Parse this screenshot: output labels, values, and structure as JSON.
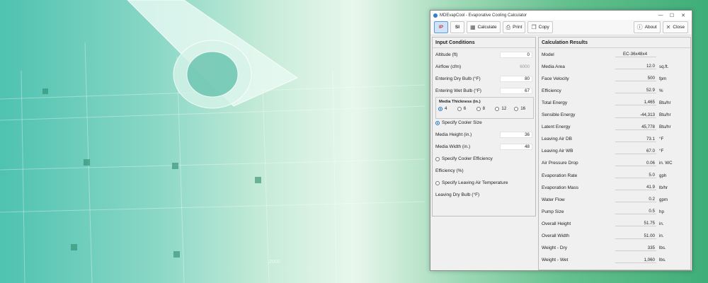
{
  "window": {
    "title": "MDEvapCool - Evaporative Cooling Calculator",
    "controls": [
      "—",
      "☐",
      "✕"
    ]
  },
  "toolbar": {
    "ip_label": "IP",
    "si_label": "SI",
    "calculate_label": "Calculate",
    "print_label": "Print",
    "copy_label": "Copy",
    "about_label": "About",
    "close_label": "Close"
  },
  "input": {
    "title": "Input Conditions",
    "altitude": {
      "label": "Altitude (ft)",
      "value": "0"
    },
    "airflow": {
      "label": "Airflow (cfm)",
      "value": "6000"
    },
    "dry_bulb": {
      "label": "Entering Dry Bulb (°F)",
      "value": "80"
    },
    "wet_bulb": {
      "label": "Entering Wet Bulb (°F)",
      "value": "67"
    },
    "thickness": {
      "title": "Media Thickness (in.)",
      "options": [
        "4",
        "6",
        "8",
        "12",
        "16"
      ],
      "selected": "4"
    },
    "specify_size": "Specify Cooler Size",
    "media_height": {
      "label": "Media Height (in.)",
      "value": "36"
    },
    "media_width": {
      "label": "Media Width (in.)",
      "value": "48"
    },
    "specify_efficiency": "Specify Cooler Efficiency",
    "efficiency_label": "Efficiency (%)",
    "specify_leaving": "Specify Leaving Air Temperature",
    "leaving_db_label": "Leaving Dry Bulb (°F)"
  },
  "results": {
    "title": "Calculation Results",
    "rows": [
      {
        "label": "Model",
        "value": "EC-36x48x4",
        "unit": ""
      },
      {
        "label": "Media Area",
        "value": "12.0",
        "unit": "sq.ft."
      },
      {
        "label": "Face Velocity",
        "value": "500",
        "unit": "fpm"
      },
      {
        "label": "Efficiency",
        "value": "52.9",
        "unit": "%"
      },
      {
        "label": "Total Energy",
        "value": "1,465",
        "unit": "Btu/hr"
      },
      {
        "label": "Sensible Energy",
        "value": "-44,313",
        "unit": "Btu/hr"
      },
      {
        "label": "Latent Energy",
        "value": "45,778",
        "unit": "Btu/hr"
      },
      {
        "label": "Leaving Air DB",
        "value": "73.1",
        "unit": "°F"
      },
      {
        "label": "Leaving Air WB",
        "value": "67.0",
        "unit": "°F"
      },
      {
        "label": "Air Pressure Drop",
        "value": "0.06",
        "unit": "in. WC"
      },
      {
        "label": "Evaporation Rate",
        "value": "5.0",
        "unit": "gph"
      },
      {
        "label": "Evaporation Mass",
        "value": "41.9",
        "unit": "lb/hr"
      },
      {
        "label": "Water Flow",
        "value": "0.2",
        "unit": "gpm"
      },
      {
        "label": "Pump Size",
        "value": "0.5",
        "unit": "hp"
      },
      {
        "label": "Overall Height",
        "value": "51.75",
        "unit": "in."
      },
      {
        "label": "Overall Width",
        "value": "51.00",
        "unit": "in."
      },
      {
        "label": "Weight - Dry",
        "value": "335",
        "unit": "lbs."
      },
      {
        "label": "Weight - Wet",
        "value": "1,060",
        "unit": "lbs."
      }
    ]
  },
  "background": {
    "dimension_text": "2000"
  }
}
